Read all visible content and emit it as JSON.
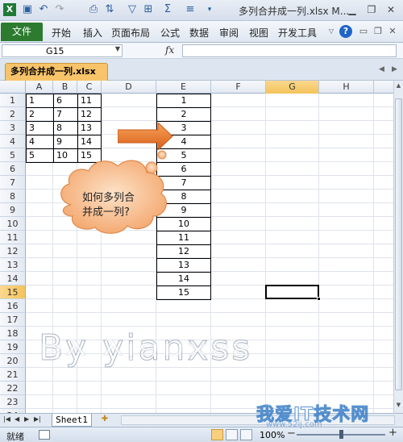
{
  "window": {
    "title": "多列合并成一列.xlsx M...",
    "minimize_icon": "minimize-icon",
    "restore_icon": "restore-icon",
    "close_icon": "close-icon"
  },
  "quick_access": {
    "icons": [
      "excel-logo-icon",
      "save-icon",
      "undo-icon",
      "redo-icon",
      "print-preview-icon",
      "sort-icon",
      "filter-icon",
      "borders-icon",
      "autosum-icon",
      "format-icon"
    ]
  },
  "ribbon": {
    "file_tab": "文件",
    "tabs": [
      "开始",
      "插入",
      "页面布局",
      "公式",
      "数据",
      "审阅",
      "视图",
      "开发工具"
    ],
    "help_label": "?"
  },
  "formula_bar": {
    "name_box": "G15",
    "fx_label": "fx",
    "formula": ""
  },
  "workbook_tab": {
    "label": "多列合并成一列.xlsx"
  },
  "sheet": {
    "columns": [
      "A",
      "B",
      "C",
      "D",
      "E",
      "F",
      "G",
      "H"
    ],
    "rows": [
      "1",
      "2",
      "3",
      "4",
      "5",
      "6",
      "7",
      "8",
      "9",
      "10",
      "11",
      "12",
      "13",
      "14",
      "15",
      "16",
      "17",
      "18",
      "19",
      "20",
      "21",
      "22",
      "23",
      "24"
    ],
    "selected_cell": "G15",
    "source_table": [
      [
        "1",
        "6",
        "11"
      ],
      [
        "2",
        "7",
        "12"
      ],
      [
        "3",
        "8",
        "13"
      ],
      [
        "4",
        "9",
        "14"
      ],
      [
        "5",
        "10",
        "15"
      ]
    ],
    "result_column": [
      "1",
      "2",
      "3",
      "4",
      "5",
      "6",
      "7",
      "8",
      "9",
      "10",
      "11",
      "12",
      "13",
      "14",
      "15"
    ],
    "callout_line1": "如何多列合",
    "callout_line2": "并成一列?",
    "watermark": "By yianxss"
  },
  "sheet_tabs": {
    "active": "Sheet1"
  },
  "status_bar": {
    "status": "就绪",
    "zoom": "100%",
    "zoom_minus": "−",
    "zoom_plus": "+"
  },
  "site_watermark": {
    "text": "我爱IT技术网",
    "url": "www.52ij.com"
  },
  "colors": {
    "file_tab": "#2c7b2f",
    "workbook_tab": "#f7c46a",
    "arrow": "#e8731f",
    "cloud": "#f9c08f"
  }
}
